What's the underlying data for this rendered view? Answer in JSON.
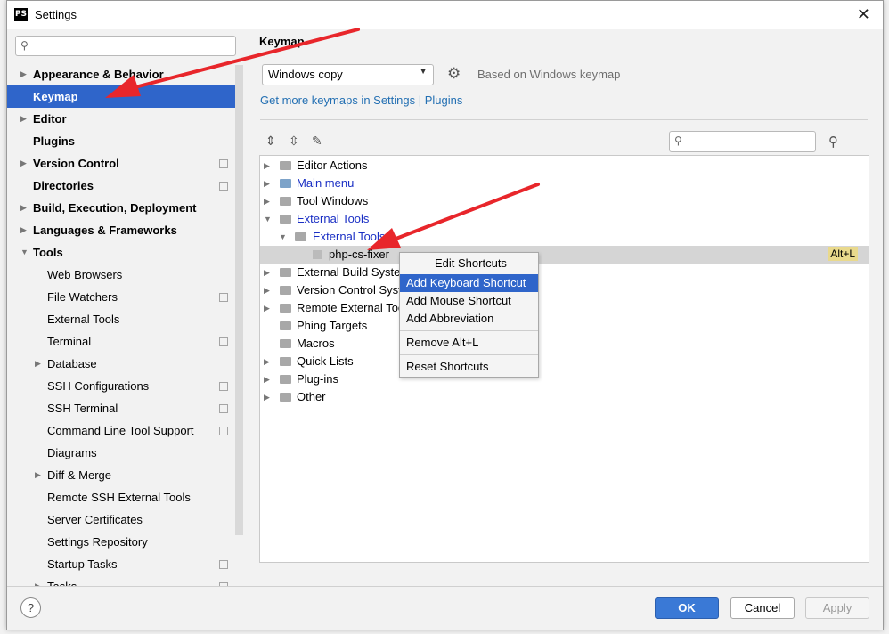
{
  "window": {
    "title": "Settings",
    "app_icon": "PS"
  },
  "sidebar": {
    "search_placeholder": "",
    "items": [
      {
        "label": "Appearance & Behavior"
      },
      {
        "label": "Keymap"
      },
      {
        "label": "Editor"
      },
      {
        "label": "Plugins"
      },
      {
        "label": "Version Control"
      },
      {
        "label": "Directories"
      },
      {
        "label": "Build, Execution, Deployment"
      },
      {
        "label": "Languages & Frameworks"
      },
      {
        "label": "Tools"
      },
      {
        "label": "Web Browsers"
      },
      {
        "label": "File Watchers"
      },
      {
        "label": "External Tools"
      },
      {
        "label": "Terminal"
      },
      {
        "label": "Database"
      },
      {
        "label": "SSH Configurations"
      },
      {
        "label": "SSH Terminal"
      },
      {
        "label": "Command Line Tool Support"
      },
      {
        "label": "Diagrams"
      },
      {
        "label": "Diff & Merge"
      },
      {
        "label": "Remote SSH External Tools"
      },
      {
        "label": "Server Certificates"
      },
      {
        "label": "Settings Repository"
      },
      {
        "label": "Startup Tasks"
      },
      {
        "label": "Tasks"
      }
    ]
  },
  "main": {
    "title": "Keymap",
    "keymap_value": "Windows copy",
    "based_on": "Based on Windows keymap",
    "link": "Get more keymaps in Settings | Plugins",
    "search_placeholder": ""
  },
  "tree": [
    {
      "label": "Editor Actions"
    },
    {
      "label": "Main menu"
    },
    {
      "label": "Tool Windows"
    },
    {
      "label": "External Tools"
    },
    {
      "label": "External Tools"
    },
    {
      "label": "php-cs-fixer",
      "shortcut": "Alt+L"
    },
    {
      "label": "External Build System"
    },
    {
      "label": "Version Control System"
    },
    {
      "label": "Remote External Tools"
    },
    {
      "label": "Phing Targets"
    },
    {
      "label": "Macros"
    },
    {
      "label": "Quick Lists"
    },
    {
      "label": "Plug-ins"
    },
    {
      "label": "Other"
    }
  ],
  "context_menu": {
    "header": "Edit Shortcuts",
    "items": [
      "Add Keyboard Shortcut",
      "Add Mouse Shortcut",
      "Add Abbreviation",
      "Remove Alt+L",
      "Reset Shortcuts"
    ]
  },
  "footer": {
    "help": "?",
    "ok": "OK",
    "cancel": "Cancel",
    "apply": "Apply"
  },
  "colors": {
    "selection": "#2f65ca",
    "modified_text": "#1a2fc4",
    "shortcut_badge": "#e9d98c",
    "annotation_arrow": "#e8262b"
  }
}
